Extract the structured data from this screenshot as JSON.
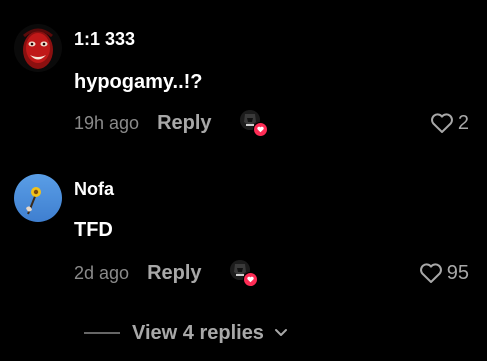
{
  "comments": [
    {
      "username": "1:1 333",
      "text": "hypogamy..!?",
      "timestamp": "19h ago",
      "reply_label": "Reply",
      "likes": "2",
      "avatar_icon": "red-face-avatar",
      "liked_by_creator": true
    },
    {
      "username": "Nofa",
      "text": "TFD",
      "timestamp": "2d ago",
      "reply_label": "Reply",
      "likes": "95",
      "avatar_icon": "sky-flower-avatar",
      "liked_by_creator": true
    }
  ],
  "view_replies": {
    "label": "View 4 replies",
    "icon": "chevron-down-icon"
  },
  "colors": {
    "background": "#000000",
    "primary_text": "#ffffff",
    "secondary_text": "#a8a8a8",
    "timestamp_text": "#8a8a8a",
    "like_badge": "#fe2c55"
  }
}
